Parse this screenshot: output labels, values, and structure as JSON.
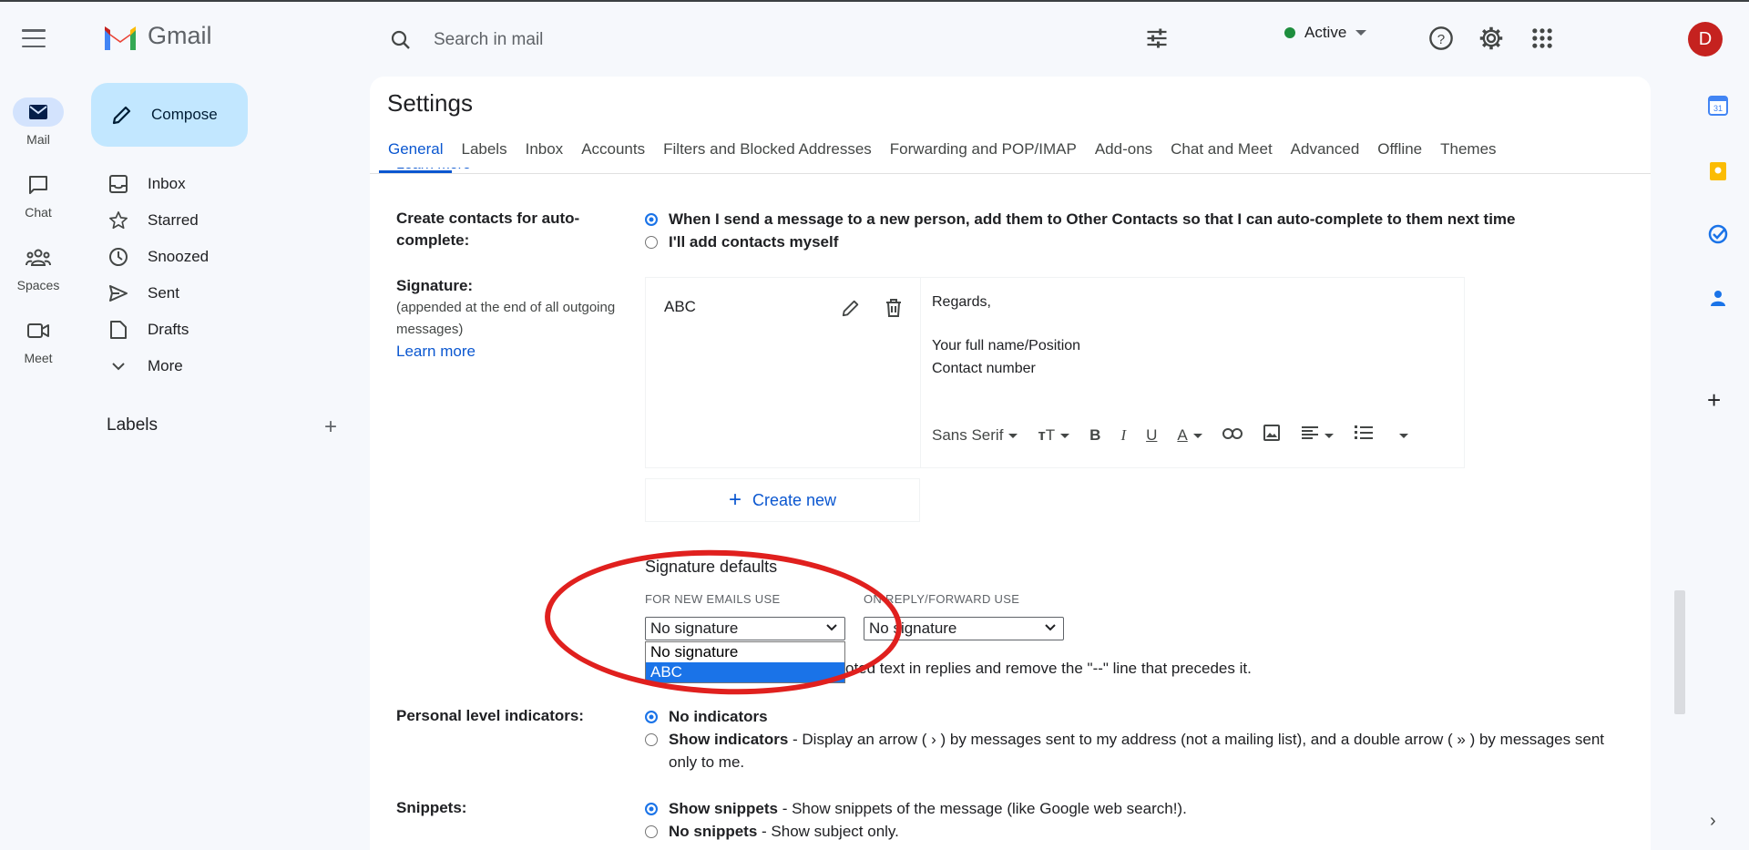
{
  "header": {
    "app_name": "Gmail",
    "search_placeholder": "Search in mail",
    "status": "Active",
    "avatar_letter": "D"
  },
  "rail": {
    "items": [
      {
        "label": "Mail"
      },
      {
        "label": "Chat"
      },
      {
        "label": "Spaces"
      },
      {
        "label": "Meet"
      }
    ]
  },
  "nav": {
    "compose": "Compose",
    "items": [
      {
        "label": "Inbox"
      },
      {
        "label": "Starred"
      },
      {
        "label": "Snoozed"
      },
      {
        "label": "Sent"
      },
      {
        "label": "Drafts"
      },
      {
        "label": "More"
      }
    ],
    "labels_header": "Labels"
  },
  "settings": {
    "title": "Settings",
    "tabs": [
      "General",
      "Labels",
      "Inbox",
      "Accounts",
      "Filters and Blocked Addresses",
      "Forwarding and POP/IMAP",
      "Add-ons",
      "Chat and Meet",
      "Advanced",
      "Offline",
      "Themes"
    ],
    "learn_more_top": "Learn more",
    "contacts": {
      "label": "Create contacts for auto-complete:",
      "opt1": "When I send a message to a new person, add them to Other Contacts so that I can auto-complete to them next time",
      "opt2": "I'll add contacts myself"
    },
    "signature": {
      "label": "Signature:",
      "sub": "(appended at the end of all outgoing messages)",
      "learn_more": "Learn more",
      "sig_name": "ABC",
      "body_line1": "Regards,",
      "body_line2": "Your full name/Position",
      "body_line3": "Contact number",
      "font": "Sans Serif",
      "create_new": "Create new",
      "defaults_title": "Signature defaults",
      "new_emails_label": "FOR NEW EMAILS USE",
      "reply_label": "ON REPLY/FORWARD USE",
      "new_emails_value": "No signature",
      "reply_value": "No signature",
      "dropdown_options": [
        "No signature",
        "ABC"
      ],
      "quoted_text": "oted text in replies and remove the \"--\" line that precedes it."
    },
    "personal": {
      "label": "Personal level indicators:",
      "opt1": "No indicators",
      "opt2_bold": "Show indicators",
      "opt2_rest": " - Display an arrow ( › ) by messages sent to my address (not a mailing list), and a double arrow ( » ) by messages sent only to me."
    },
    "snippets": {
      "label": "Snippets:",
      "opt1_bold": "Show snippets",
      "opt1_rest": " - Show snippets of the message (like Google web search!).",
      "opt2_bold": "No snippets",
      "opt2_rest": " - Show subject only."
    }
  },
  "colors": {
    "accent": "#0b57d0",
    "compose_bg": "#c2e7ff",
    "highlight": "#e0201e",
    "avatar_bg": "#c5221f"
  }
}
